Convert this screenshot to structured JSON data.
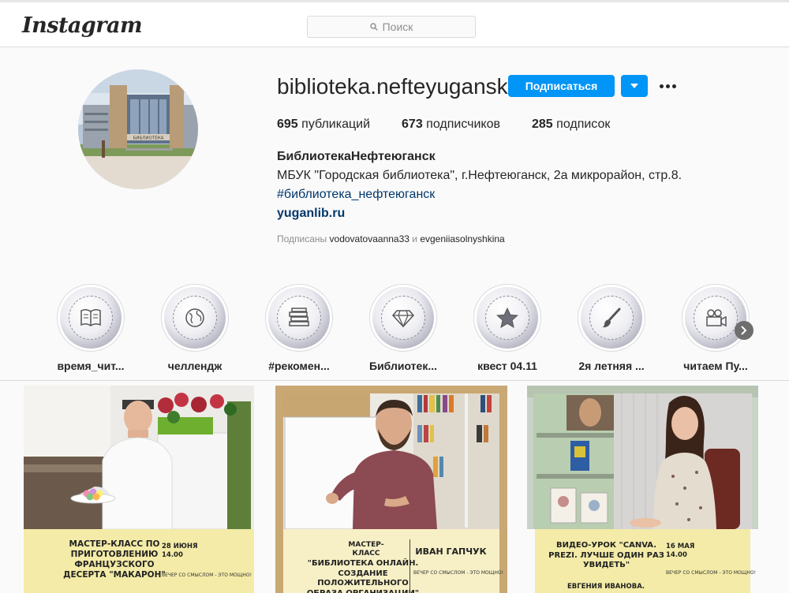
{
  "header": {
    "logo": "Instagram",
    "search_placeholder": "Поиск"
  },
  "profile": {
    "username": "biblioteka.nefteyugansk",
    "follow_label": "Подписаться",
    "posts_count": "695",
    "posts_label": "публикаций",
    "followers_count": "673",
    "followers_label": "подписчиков",
    "following_count": "285",
    "following_label": "подписок",
    "full_name": "БиблиотекаНефтеюганск",
    "bio": "МБУК \"Городская библиотека\", г.Нефтеюганск, 2а микрорайон, стр.8.",
    "hashtag": "#библиотека_нефтеюганск",
    "website": "yuganlib.ru",
    "followed_by_prefix": "Подписаны",
    "followed_by_user1": "vodovatovaanna33",
    "followed_by_and": "и",
    "followed_by_user2": "evgeniiasolnyshkina",
    "avatar_sign": "БИБЛИОТЕКА"
  },
  "highlights": [
    {
      "label": "время_чит...",
      "icon": "book-icon"
    },
    {
      "label": "челлендж",
      "icon": "globe-icon"
    },
    {
      "label": "#рекомен...",
      "icon": "books-stack-icon"
    },
    {
      "label": "Библиотек...",
      "icon": "diamond-icon"
    },
    {
      "label": "квест 04.11",
      "icon": "star-icon"
    },
    {
      "label": "2я летняя ...",
      "icon": "paintbrush-icon"
    },
    {
      "label": "читаем Пу...",
      "icon": "camera-icon"
    }
  ],
  "posts": [
    {
      "title": "МАСТЕР-КЛАСС ПО ПРИГОТОВЛЕНИЮ ФРАНЦУЗСКОГО ДЕСЕРТА \"МАКАРОН\"",
      "date": "28 ИЮНЯ",
      "time": "14.00",
      "tagline": "ВЕЧЕР СО СМЫСЛОМ - ЭТО МОЩНО!"
    },
    {
      "kicker": "МАСТЕР-КЛАСС",
      "title": "\"БИБЛИОТЕКА ОНЛАЙН. СОЗДАНИЕ ПОЛОЖИТЕЛЬНОГО ОБРАЗА ОРГАНИЗАЦИИ\"",
      "name": "ИВАН ГАПЧУК",
      "tagline": "ВЕЧЕР СО СМЫСЛОМ - ЭТО МОЩНО!"
    },
    {
      "title": "ВИДЕО-УРОК \"CANVA. PREZI. ЛУЧШЕ ОДИН РАЗ УВИДЕТЬ\"",
      "name": "ЕВГЕНИЯ ИВАНОВА.",
      "date": "16 МАЯ",
      "time": "14.00",
      "tagline": "ВЕЧЕР СО СМЫСЛОМ - ЭТО МОЩНО!"
    }
  ],
  "colors": {
    "accent": "#0095f6",
    "link": "#00376b",
    "caption_bg": "#f3eba7"
  }
}
